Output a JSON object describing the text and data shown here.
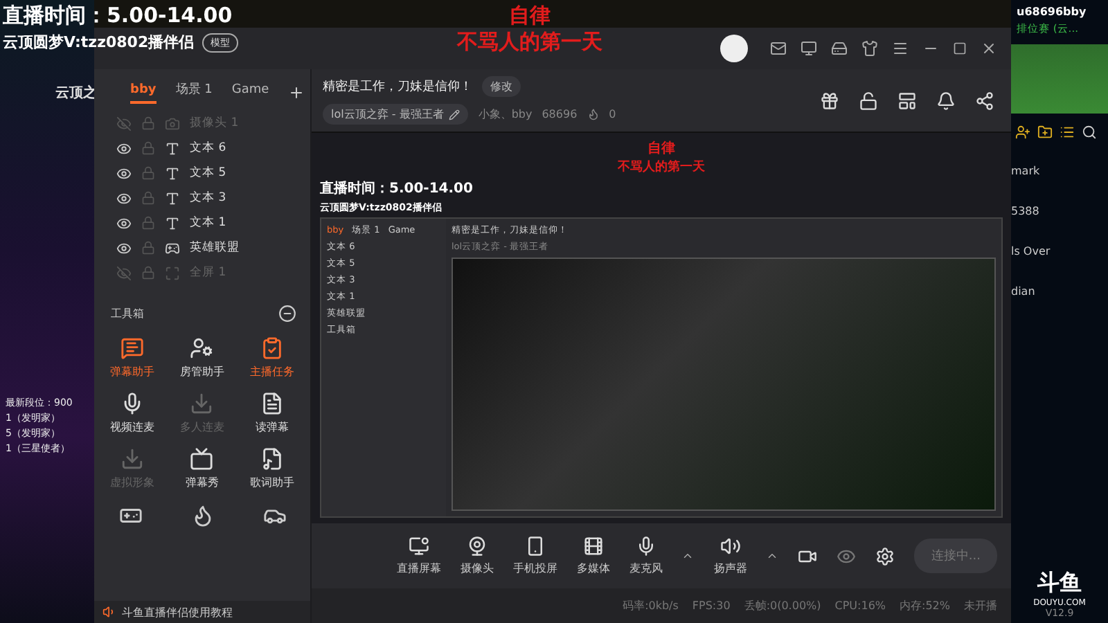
{
  "overlay": {
    "schedule": "直播时间：5.00-14.00",
    "contact": "云顶圆梦V:tzz0802播伴侣",
    "contact_badge": "模型",
    "motto_top": "自律",
    "motto": "不骂人的第一天"
  },
  "game_side": {
    "title": "云顶之",
    "stats": [
      "最新段位：900",
      "1（发明家）",
      "5（发明家）",
      "1（三星使者）"
    ]
  },
  "scene_tabs": [
    {
      "label": "bby",
      "selected": true
    },
    {
      "label": "场景 1",
      "selected": false
    },
    {
      "label": "Game",
      "selected": false
    }
  ],
  "sources": [
    {
      "name": "摄像头 1",
      "kind": "camera",
      "visible": false
    },
    {
      "name": "文本 6",
      "kind": "text",
      "visible": true
    },
    {
      "name": "文本 5",
      "kind": "text",
      "visible": true
    },
    {
      "name": "文本 3",
      "kind": "text",
      "visible": true
    },
    {
      "name": "文本 1",
      "kind": "text",
      "visible": true
    },
    {
      "name": "英雄联盟",
      "kind": "game",
      "visible": true
    },
    {
      "name": "全屏 1",
      "kind": "screen",
      "visible": false
    }
  ],
  "toolbox": {
    "title": "工具箱",
    "tools": [
      {
        "label": "弹幕助手",
        "kind": "danmu",
        "active": true,
        "disabled": false
      },
      {
        "label": "房管助手",
        "kind": "admin",
        "active": false,
        "disabled": false
      },
      {
        "label": "主播任务",
        "kind": "task",
        "active": true,
        "disabled": false
      },
      {
        "label": "视频连麦",
        "kind": "video",
        "active": false,
        "disabled": false
      },
      {
        "label": "多人连麦",
        "kind": "download",
        "active": false,
        "disabled": true
      },
      {
        "label": "读弹幕",
        "kind": "read",
        "active": false,
        "disabled": false
      },
      {
        "label": "虚拟形象",
        "kind": "download",
        "active": false,
        "disabled": true
      },
      {
        "label": "弹幕秀",
        "kind": "show",
        "active": false,
        "disabled": false
      },
      {
        "label": "歌词助手",
        "kind": "lyrics",
        "active": false,
        "disabled": false
      }
    ],
    "footer": "斗鱼直播伴侣使用教程"
  },
  "header": {
    "title": "精密是工作，刀妹是信仰！",
    "edit": "修改",
    "category": "lol云顶之弈 - 最强王者",
    "user": "小象、bby",
    "room": "68696",
    "heat": "0"
  },
  "preview": {
    "motto_top": "自律",
    "motto": "不骂人的第一天",
    "schedule": "直播时间：5.00-14.00",
    "contact": "云顶圆梦V:tzz0802播伴侣",
    "title": "精密是工作，刀妹是信仰！",
    "category": "lol云顶之弈 - 最强王者",
    "tabs": [
      "bby",
      "场景 1",
      "Game"
    ],
    "sources": [
      "文本 6",
      "文本 5",
      "文本 3",
      "文本 1",
      "英雄联盟"
    ],
    "toolbox": "工具箱"
  },
  "controls": [
    {
      "label": "直播屏幕",
      "kind": "screen"
    },
    {
      "label": "摄像头",
      "kind": "camera"
    },
    {
      "label": "手机投屏",
      "kind": "phone"
    },
    {
      "label": "多媒体",
      "kind": "media"
    },
    {
      "label": "麦克风",
      "kind": "mic"
    },
    {
      "label": "扬声器",
      "kind": "speaker"
    }
  ],
  "connect": "连接中...",
  "status": [
    "码率:0kb/s",
    "FPS:30",
    "丢帧:0(0.00%)",
    "CPU:16%",
    "内存:52%",
    "未开播"
  ],
  "right_strip": {
    "user": "u68696bby",
    "rank": "排位赛 (云...",
    "lines": [
      "mark",
      "5388",
      "ls Over",
      "dian"
    ],
    "logo": "斗鱼",
    "logo_sub": "DOUYU.COM",
    "version": "V12.9"
  }
}
